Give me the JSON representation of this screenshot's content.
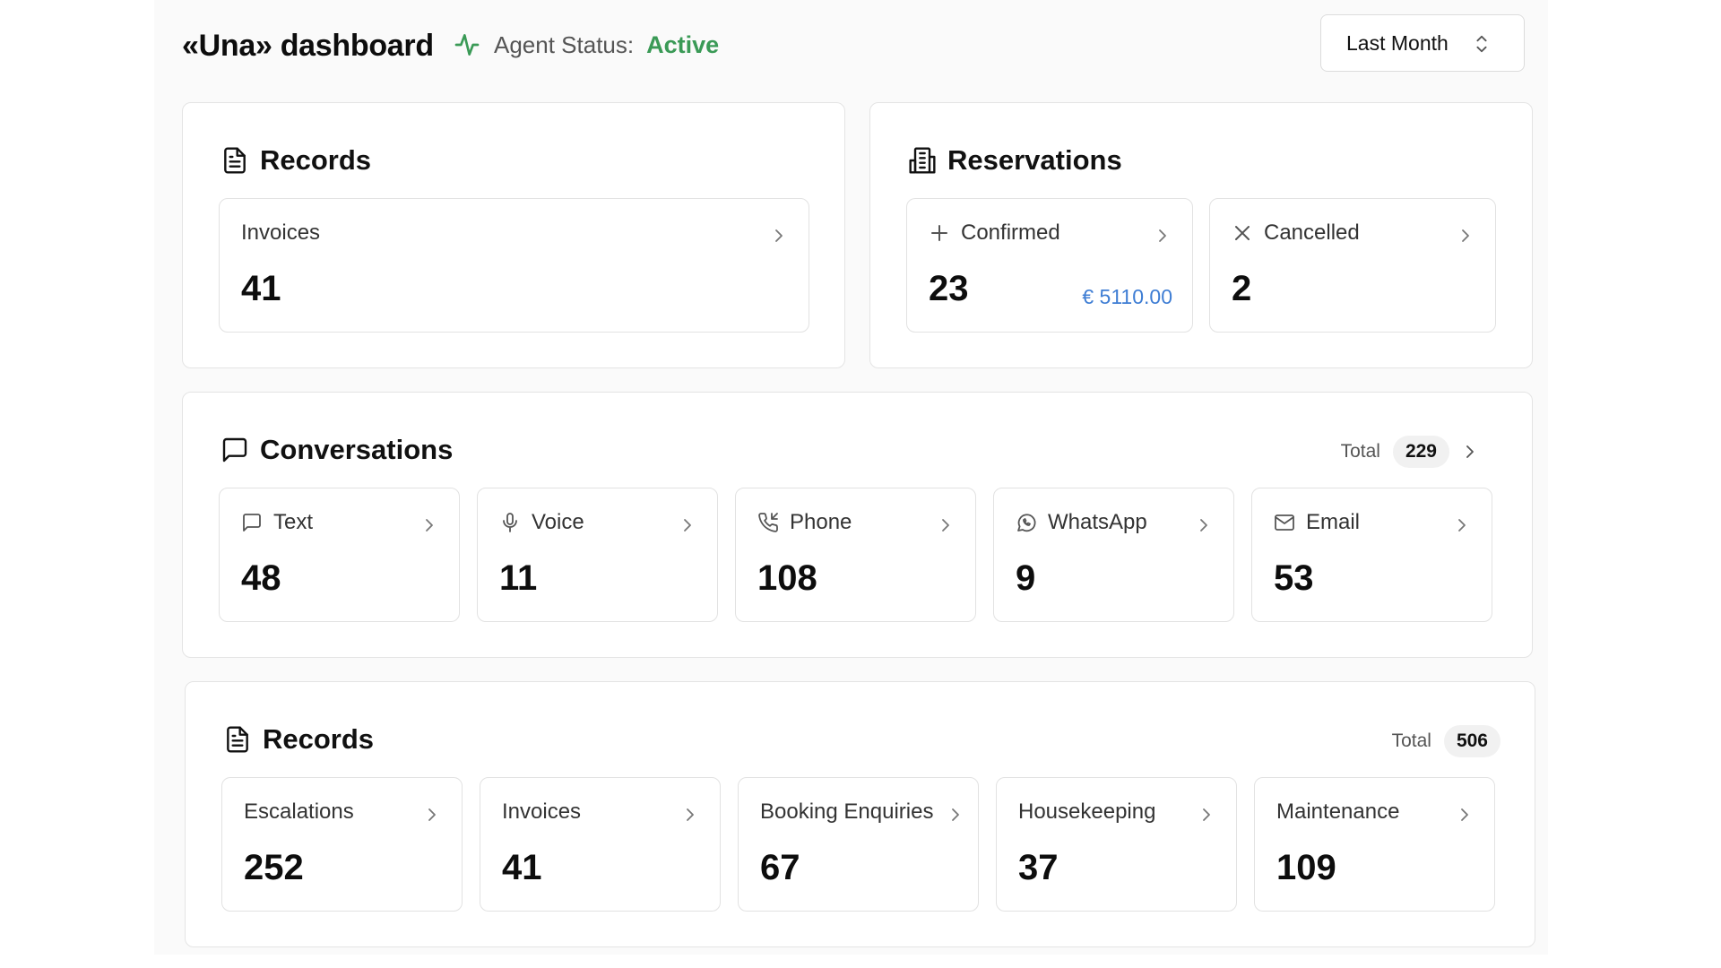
{
  "header": {
    "title": "«Una» dashboard",
    "status_label": "Agent Status:",
    "status_value": "Active",
    "status_color": "#3a9a56",
    "period": "Last Month"
  },
  "records_top": {
    "title": "Records",
    "cards": [
      {
        "label": "Invoices",
        "value": "41"
      }
    ]
  },
  "reservations": {
    "title": "Reservations",
    "confirmed": {
      "label": "Confirmed",
      "value": "23",
      "amount": "€ 5110.00"
    },
    "cancelled": {
      "label": "Cancelled",
      "value": "2"
    }
  },
  "conversations": {
    "title": "Conversations",
    "total_label": "Total",
    "total_value": "229",
    "cards": [
      {
        "label": "Text",
        "value": "48",
        "icon": "message-square-icon"
      },
      {
        "label": "Voice",
        "value": "11",
        "icon": "microphone-icon"
      },
      {
        "label": "Phone",
        "value": "108",
        "icon": "phone-incoming-icon"
      },
      {
        "label": "WhatsApp",
        "value": "9",
        "icon": "whatsapp-icon"
      },
      {
        "label": "Email",
        "value": "53",
        "icon": "mail-icon"
      }
    ]
  },
  "records_bottom": {
    "title": "Records",
    "total_label": "Total",
    "total_value": "506",
    "cards": [
      {
        "label": "Escalations",
        "value": "252"
      },
      {
        "label": "Invoices",
        "value": "41"
      },
      {
        "label": "Booking Enquiries",
        "value": "67"
      },
      {
        "label": "Housekeeping",
        "value": "37"
      },
      {
        "label": "Maintenance",
        "value": "109"
      }
    ]
  }
}
